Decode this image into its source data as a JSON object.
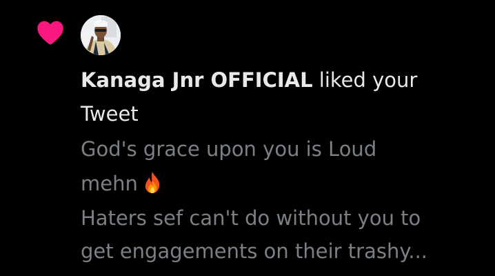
{
  "notification": {
    "type": "like",
    "accent_color": "#f91880",
    "user_name": "Kanaga Jnr OFFICIAL",
    "action_text": " liked your",
    "object_text": "Tweet",
    "tweet_lines": [
      "God's grace upon you is Loud",
      "mehn",
      "Haters sef can't do without you to",
      "get engagements on their trashy..."
    ],
    "icons": {
      "heart": "heart-icon",
      "fire": "fire-emoji-icon",
      "avatar": "user-avatar"
    }
  }
}
